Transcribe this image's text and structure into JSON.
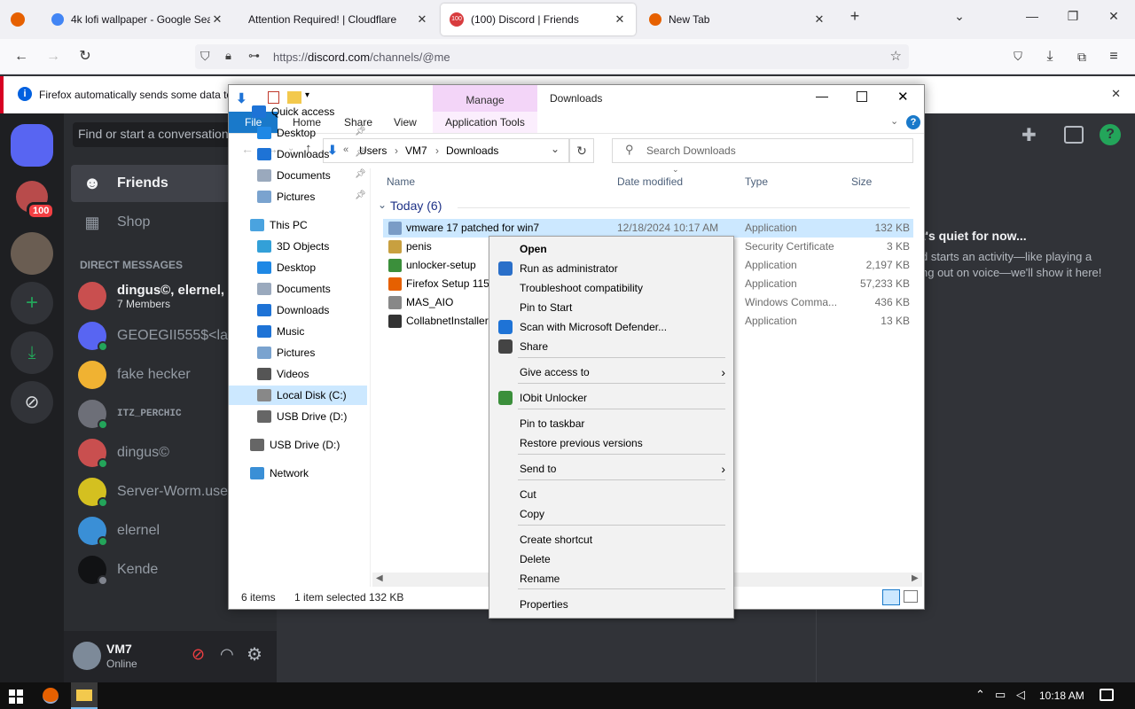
{
  "browser": {
    "tabs": [
      {
        "label": "4k lofi wallpaper - Google Sear",
        "icon": "google-icon"
      },
      {
        "label": "Attention Required! | Cloudflare",
        "icon": "cloudflare-icon"
      },
      {
        "label": "(100) Discord | Friends",
        "icon": "discord-icon",
        "badge": "100"
      },
      {
        "label": "New Tab",
        "icon": "firefox-icon"
      }
    ],
    "url_prefix": "https://",
    "url_domain": "discord.com",
    "url_path": "/channels/@me",
    "notification": "Firefox automatically sends some data to"
  },
  "discord": {
    "search_placeholder": "Find or start a conversation",
    "server_badge": "100",
    "nav": [
      {
        "label": "Friends",
        "icon": "friends-icon"
      },
      {
        "label": "Shop",
        "icon": "shop-icon"
      }
    ],
    "dm_header": "DIRECT MESSAGES",
    "dms": [
      {
        "name": "dingus©, elernel, S",
        "sub": "7 Members",
        "color": "#c94f4f",
        "status": ""
      },
      {
        "name": "GEOEGII555$<lam",
        "sub": "",
        "color": "#5865f2",
        "status": "online"
      },
      {
        "name": "fake hecker",
        "sub": "",
        "color": "#f0b232",
        "status": ""
      },
      {
        "name": "ITZ_PERCHIC",
        "sub": "",
        "color": "#6d6f78",
        "status": "online"
      },
      {
        "name": "dingus©",
        "sub": "",
        "color": "#c94f4f",
        "status": "online"
      },
      {
        "name": "Server-Worm.user",
        "sub": "",
        "color": "#d4c020",
        "status": "online"
      },
      {
        "name": "elernel",
        "sub": "",
        "color": "#3a8fd6",
        "status": "online"
      },
      {
        "name": "Kende",
        "sub": "",
        "color": "#111214",
        "status": "offline"
      }
    ],
    "user": {
      "name": "VM7",
      "status": "Online"
    },
    "activity_title": "t's quiet for now...",
    "activity_line1": "d starts an activity—like playing a",
    "activity_line2": "ng out on voice—we'll show it here!"
  },
  "explorer": {
    "title": "Downloads",
    "manage_tab": "Manage",
    "ribbon_tabs": [
      "File",
      "Home",
      "Share",
      "View",
      "Application Tools"
    ],
    "breadcrumb": [
      "Users",
      "VM7",
      "Downloads"
    ],
    "search_placeholder": "Search Downloads",
    "nav": [
      {
        "label": "Quick access",
        "icon": "star-icon",
        "pin": false
      },
      {
        "label": "Desktop",
        "icon": "desktop-icon",
        "pin": true
      },
      {
        "label": "Downloads",
        "icon": "download-icon",
        "pin": true
      },
      {
        "label": "Documents",
        "icon": "documents-icon",
        "pin": true
      },
      {
        "label": "Pictures",
        "icon": "pictures-icon",
        "pin": true
      },
      {
        "label": "This PC",
        "icon": "pc-icon",
        "pin": false
      },
      {
        "label": "3D Objects",
        "icon": "cube-icon",
        "pin": false
      },
      {
        "label": "Desktop",
        "icon": "desktop-icon",
        "pin": false
      },
      {
        "label": "Documents",
        "icon": "documents-icon",
        "pin": false
      },
      {
        "label": "Downloads",
        "icon": "download-icon",
        "pin": false
      },
      {
        "label": "Music",
        "icon": "music-icon",
        "pin": false
      },
      {
        "label": "Pictures",
        "icon": "pictures-icon",
        "pin": false
      },
      {
        "label": "Videos",
        "icon": "videos-icon",
        "pin": false
      },
      {
        "label": "Local Disk (C:)",
        "icon": "disk-icon",
        "pin": false
      },
      {
        "label": "USB Drive (D:)",
        "icon": "usb-icon",
        "pin": false
      },
      {
        "label": "USB Drive (D:)",
        "icon": "usb-icon",
        "pin": false
      },
      {
        "label": "Network",
        "icon": "network-icon",
        "pin": false
      }
    ],
    "columns": [
      "Name",
      "Date modified",
      "Type",
      "Size"
    ],
    "group": "Today (6)",
    "files": [
      {
        "name": "vmware 17 patched for win7",
        "date": "12/18/2024 10:17 AM",
        "type": "Application",
        "size": "132 KB",
        "color": "#7a9cc6"
      },
      {
        "name": "penis",
        "date": "",
        "type": "Security Certificate",
        "size": "3 KB",
        "color": "#c8a040"
      },
      {
        "name": "unlocker-setup",
        "date": "",
        "type": "Application",
        "size": "2,197 KB",
        "color": "#3b8f3b"
      },
      {
        "name": "Firefox Setup 115.",
        "date": "",
        "type": "Application",
        "size": "57,233 KB",
        "color": "#e66000"
      },
      {
        "name": "MAS_AIO",
        "date": "",
        "type": "Windows Comma...",
        "size": "436 KB",
        "color": "#888888"
      },
      {
        "name": "CollabnetInstaller",
        "date": "",
        "type": "Application",
        "size": "13 KB",
        "color": "#333333"
      }
    ],
    "status_items": "6 items",
    "status_selected": "1 item selected",
    "status_size": "132 KB"
  },
  "context_menu": {
    "items": [
      {
        "label": "Open",
        "bold": true,
        "icon": "",
        "submenu": false
      },
      {
        "label": "Run as administrator",
        "bold": false,
        "icon": "shield-icon",
        "submenu": false
      },
      {
        "label": "Troubleshoot compatibility",
        "bold": false,
        "icon": "",
        "submenu": false
      },
      {
        "label": "Pin to Start",
        "bold": false,
        "icon": "",
        "submenu": false
      },
      {
        "label": "Scan with Microsoft Defender...",
        "bold": false,
        "icon": "defender-icon",
        "submenu": false
      },
      {
        "label": "Share",
        "bold": false,
        "icon": "share-icon",
        "submenu": false
      },
      {
        "label": "Give access to",
        "bold": false,
        "icon": "",
        "submenu": true
      },
      {
        "label": "IObit Unlocker",
        "bold": false,
        "icon": "iobit-icon",
        "submenu": false
      },
      {
        "label": "Pin to taskbar",
        "bold": false,
        "icon": "",
        "submenu": false
      },
      {
        "label": "Restore previous versions",
        "bold": false,
        "icon": "",
        "submenu": false
      },
      {
        "label": "Send to",
        "bold": false,
        "icon": "",
        "submenu": true
      },
      {
        "label": "Cut",
        "bold": false,
        "icon": "",
        "submenu": false
      },
      {
        "label": "Copy",
        "bold": false,
        "icon": "",
        "submenu": false
      },
      {
        "label": "Create shortcut",
        "bold": false,
        "icon": "",
        "submenu": false
      },
      {
        "label": "Delete",
        "bold": false,
        "icon": "",
        "submenu": false
      },
      {
        "label": "Rename",
        "bold": false,
        "icon": "",
        "submenu": false
      },
      {
        "label": "Properties",
        "bold": false,
        "icon": "",
        "submenu": false
      }
    ]
  },
  "taskbar": {
    "time": "10:18 AM"
  },
  "colors": {
    "discord_blurple": "#5865f2",
    "online": "#23a55a",
    "selection": "#cce8ff",
    "firefox_accent": "#0060df"
  }
}
